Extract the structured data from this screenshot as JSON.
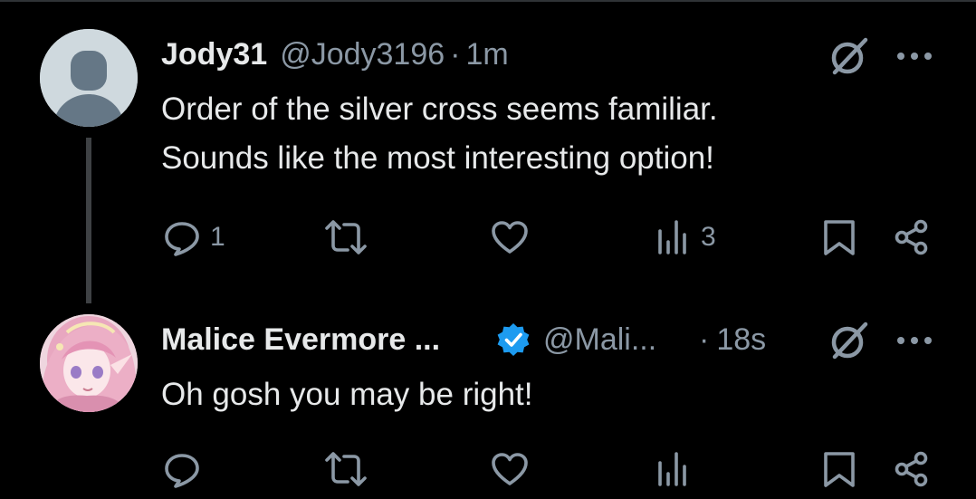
{
  "colors": {
    "background": "#000000",
    "text_primary": "#e7e9ea",
    "text_secondary": "#8b98a5",
    "verified_blue": "#1d9bf0",
    "thread_line": "#3e4144"
  },
  "tweets": [
    {
      "display_name": "Jody31",
      "handle": "@Jody3196",
      "separator": "·",
      "time": "1m",
      "avatar": "default-avatar-icon",
      "text_lines": [
        "Order of the silver cross seems familiar.",
        "Sounds like the most interesting option!"
      ],
      "metrics": {
        "replies": "1",
        "views": "3"
      }
    },
    {
      "display_name": "Malice Evermore ...",
      "verified": true,
      "handle": "@Mali...",
      "separator": "·",
      "time": "18s",
      "avatar": "anime-character-avatar",
      "text_lines": [
        "Oh gosh you may be right!"
      ]
    }
  ]
}
